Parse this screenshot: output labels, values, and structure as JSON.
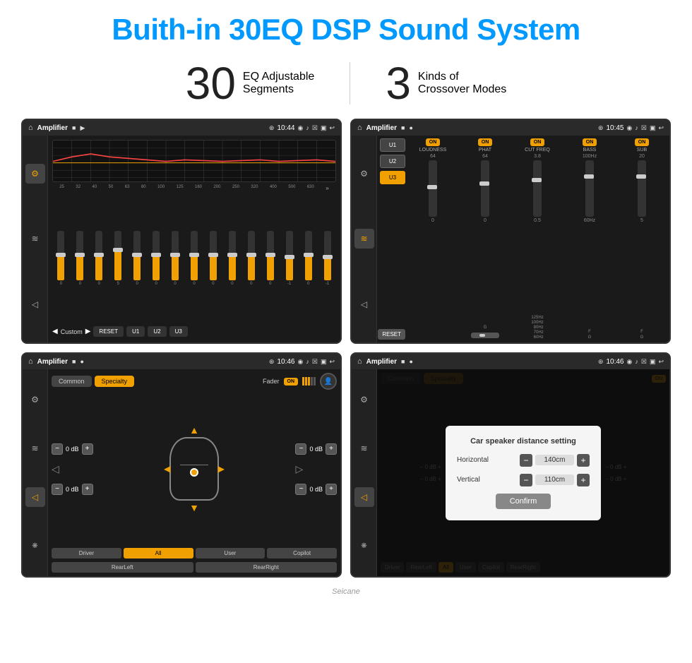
{
  "page": {
    "title": "Buith-in 30EQ DSP Sound System",
    "watermark": "Seicane"
  },
  "stats": {
    "eq": {
      "number": "30",
      "desc_line1": "EQ Adjustable",
      "desc_line2": "Segments"
    },
    "crossover": {
      "number": "3",
      "desc_line1": "Kinds of",
      "desc_line2": "Crossover Modes"
    }
  },
  "screens": {
    "eq": {
      "title": "Amplifier",
      "time": "10:44",
      "freq_labels": [
        "25",
        "32",
        "40",
        "50",
        "63",
        "80",
        "100",
        "125",
        "160",
        "200",
        "250",
        "320",
        "400",
        "500",
        "630"
      ],
      "slider_values": [
        "0",
        "0",
        "0",
        "5",
        "0",
        "0",
        "0",
        "0",
        "0",
        "0",
        "0",
        "0",
        "-1",
        "0",
        "-1"
      ],
      "bottom_label": "Custom",
      "buttons": [
        "RESET",
        "U1",
        "U2",
        "U3"
      ]
    },
    "crossover": {
      "title": "Amplifier",
      "time": "10:45",
      "presets": [
        "U1",
        "U2",
        "U3"
      ],
      "active_preset": "U3",
      "channels": [
        {
          "name": "LOUDNESS",
          "on": true
        },
        {
          "name": "PHAT",
          "on": true
        },
        {
          "name": "CUT FREQ",
          "on": true
        },
        {
          "name": "BASS",
          "on": true
        },
        {
          "name": "SUB",
          "on": true
        }
      ],
      "reset_label": "RESET"
    },
    "specialty": {
      "title": "Amplifier",
      "time": "10:46",
      "tabs": [
        "Common",
        "Specialty"
      ],
      "active_tab": "Specialty",
      "fader_label": "Fader",
      "fader_on": "ON",
      "db_values": [
        "0 dB",
        "0 dB",
        "0 dB",
        "0 dB"
      ],
      "bottom_buttons": [
        "Driver",
        "RearLeft",
        "All",
        "User",
        "Copilot",
        "RearRight"
      ],
      "active_bottom": "All"
    },
    "distance": {
      "title": "Amplifier",
      "time": "10:46",
      "dialog": {
        "title": "Car speaker distance setting",
        "horizontal_label": "Horizontal",
        "horizontal_value": "140cm",
        "vertical_label": "Vertical",
        "vertical_value": "110cm",
        "confirm_label": "Confirm"
      },
      "bottom_buttons": [
        "Driver",
        "RearLeft",
        "All",
        "User",
        "Copilot",
        "RearRight"
      ]
    }
  },
  "icons": {
    "home": "⌂",
    "eq_icon": "⚙",
    "wave_icon": "≋",
    "speaker_icon": "◁",
    "bluetooth": "❋",
    "location": "⊛",
    "camera": "◉",
    "volume": "♪",
    "close_box": "☒",
    "monitor": "▣",
    "back_arrow": "↩",
    "play": "▶",
    "prev": "◀",
    "next_arr": "»",
    "plus": "+",
    "minus": "−"
  }
}
